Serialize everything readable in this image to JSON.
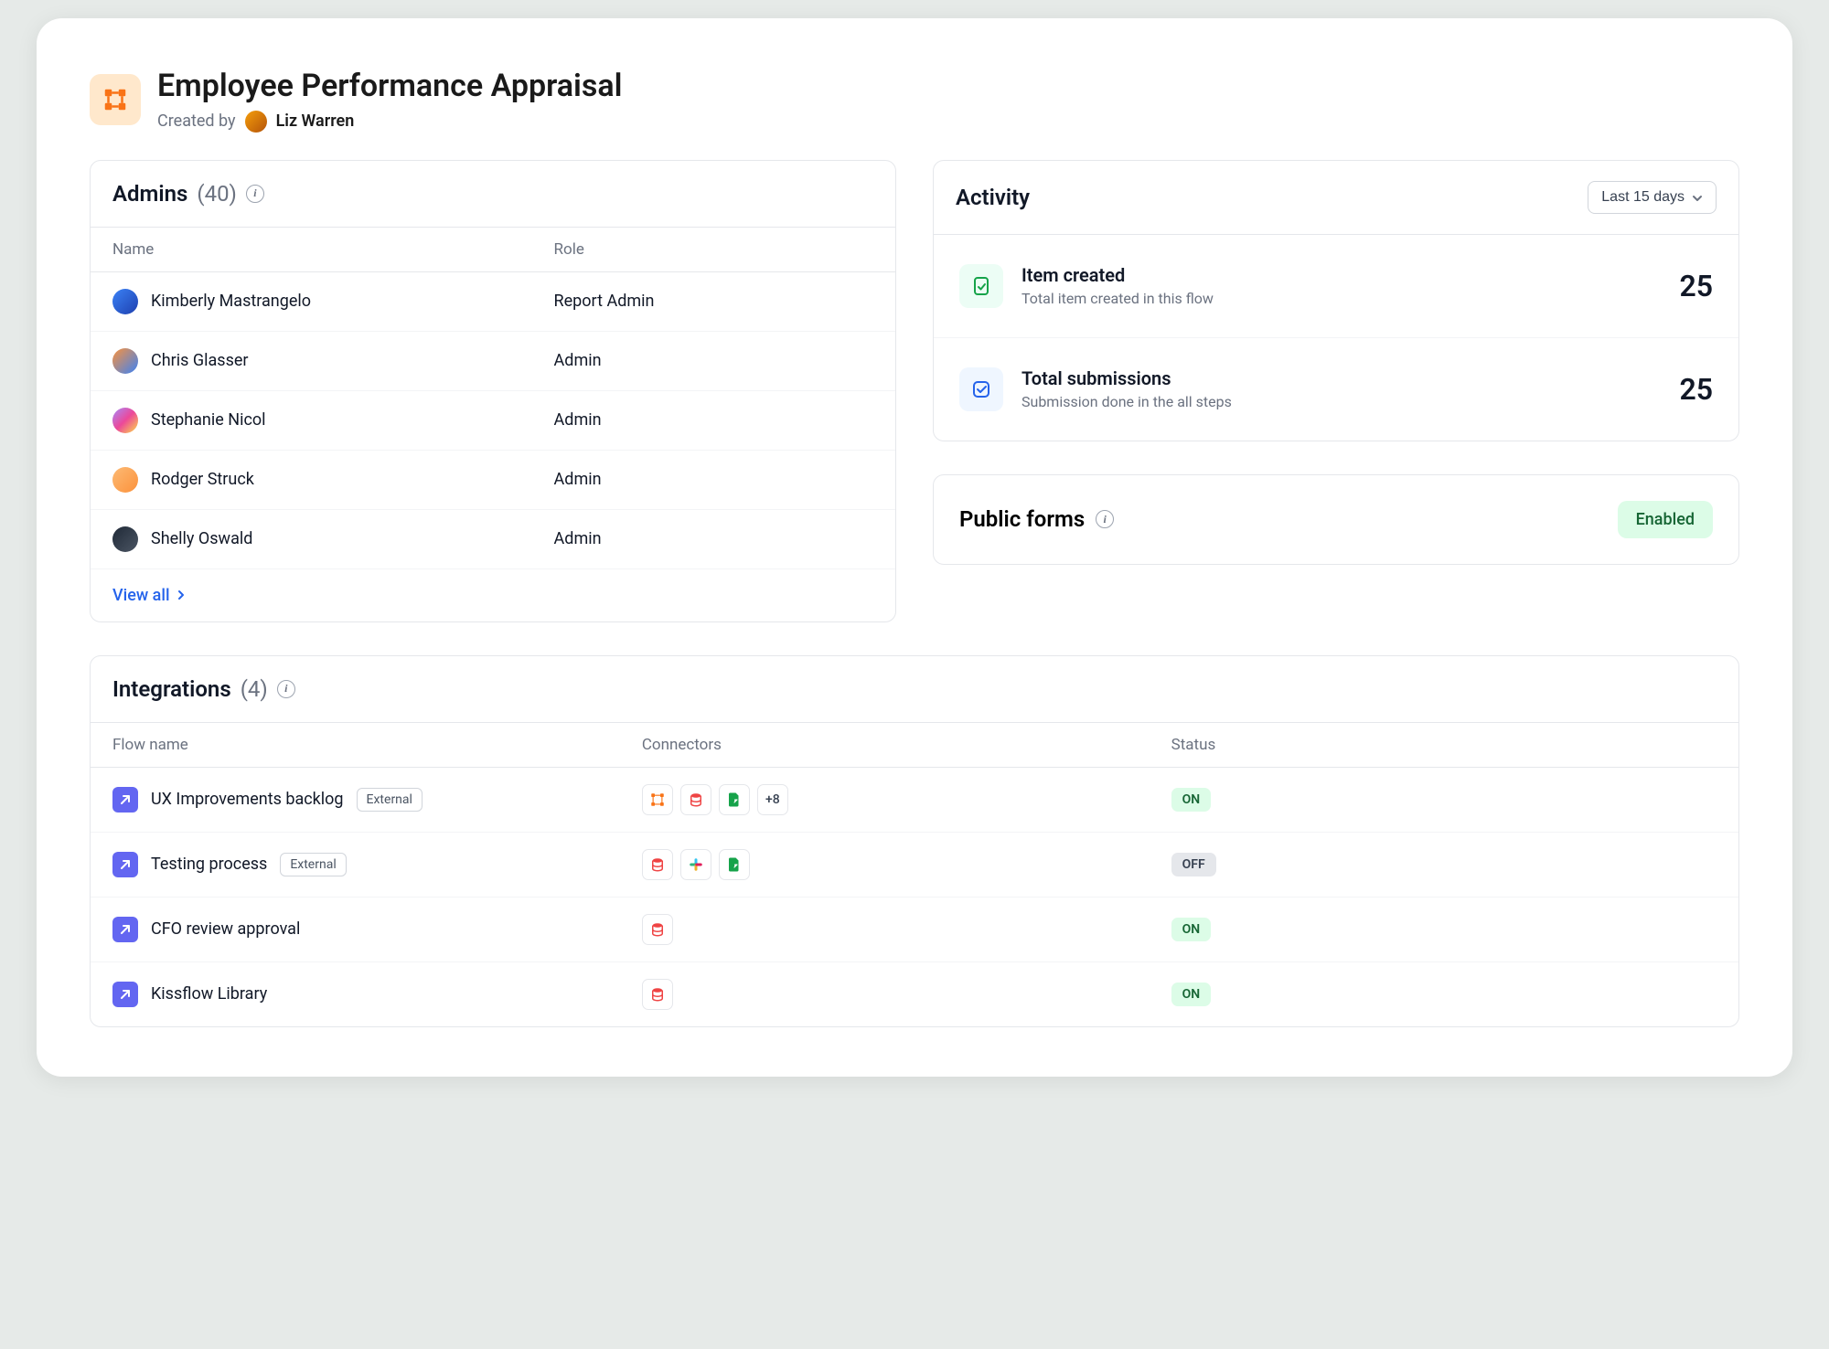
{
  "header": {
    "title": "Employee Performance Appraisal",
    "created_label": "Created by",
    "creator": "Liz Warren"
  },
  "admins": {
    "title": "Admins",
    "count": "(40)",
    "columns": {
      "name": "Name",
      "role": "Role"
    },
    "rows": [
      {
        "name": "Kimberly Mastrangelo",
        "role": "Report Admin"
      },
      {
        "name": "Chris Glasser",
        "role": "Admin"
      },
      {
        "name": "Stephanie Nicol",
        "role": "Admin"
      },
      {
        "name": "Rodger Struck",
        "role": "Admin"
      },
      {
        "name": "Shelly Oswald",
        "role": "Admin"
      }
    ],
    "view_all": "View all"
  },
  "activity": {
    "title": "Activity",
    "range": "Last 15 days",
    "items": [
      {
        "title": "Item created",
        "sub": "Total item created in this flow",
        "value": "25"
      },
      {
        "title": "Total submissions",
        "sub": "Submission done in the all steps",
        "value": "25"
      }
    ]
  },
  "public_forms": {
    "title": "Public forms",
    "status": "Enabled"
  },
  "integrations": {
    "title": "Integrations",
    "count": "(4)",
    "columns": {
      "flow": "Flow name",
      "connectors": "Connectors",
      "status": "Status"
    },
    "rows": [
      {
        "name": "UX Improvements backlog",
        "external": "External",
        "more": "+8",
        "status": "ON"
      },
      {
        "name": "Testing process",
        "external": "External",
        "status": "OFF"
      },
      {
        "name": "CFO review approval",
        "status": "ON"
      },
      {
        "name": "Kissflow Library",
        "status": "ON"
      }
    ]
  }
}
